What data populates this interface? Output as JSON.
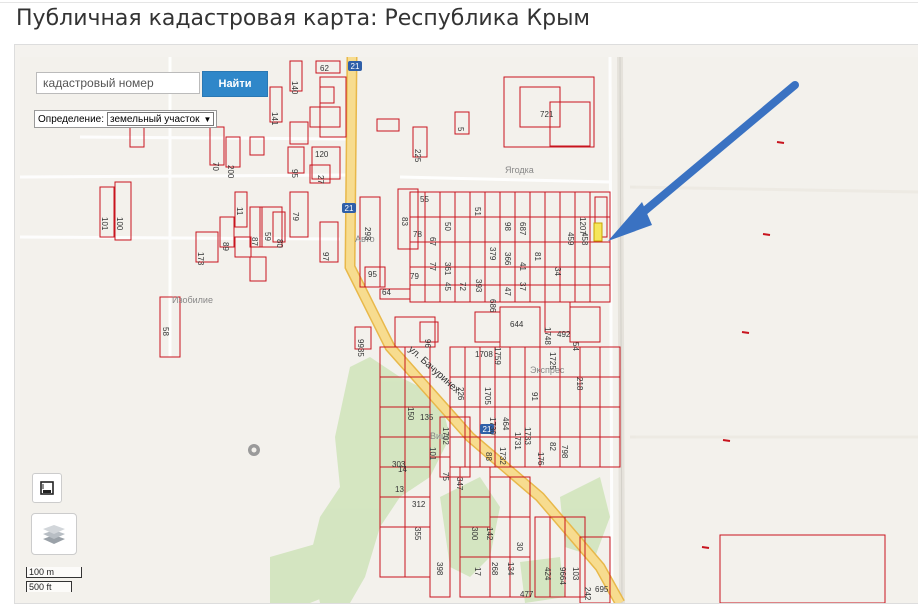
{
  "page": {
    "title": "Публичная кадастровая карта: Республика Крым"
  },
  "search": {
    "placeholder": "кадастровый номер",
    "button_label": "Найти"
  },
  "definition": {
    "label": "Определение:",
    "selected": "земельный участок"
  },
  "scale": {
    "metric": "100 m",
    "imperial": "500 ft"
  },
  "map": {
    "street_label": "ул. Бачуринех",
    "place_labels": [
      "Ягодка",
      "Изобилие",
      "Авто",
      "Экспрес",
      "Виш"
    ],
    "road_shields": [
      "21",
      "21",
      "21"
    ],
    "parcel_numbers": [
      "62",
      "140",
      "141",
      "5",
      "225",
      "721",
      "120",
      "27",
      "95",
      "70",
      "200",
      "101",
      "100",
      "11",
      "79",
      "87",
      "89",
      "59",
      "80",
      "173",
      "97",
      "58",
      "293",
      "83",
      "55",
      "50",
      "51",
      "98",
      "687",
      "1207",
      "78",
      "67",
      "379",
      "366",
      "459",
      "458",
      "77",
      "361",
      "41",
      "81",
      "79",
      "45",
      "72",
      "393",
      "686",
      "47",
      "37",
      "34",
      "95",
      "64",
      "644",
      "1748",
      "1725",
      "1759",
      "54",
      "492",
      "96",
      "9935",
      "1708",
      "1705",
      "218",
      "226",
      "91",
      "150",
      "135",
      "1702",
      "464",
      "1730",
      "1733",
      "1731",
      "1732",
      "88",
      "82",
      "798",
      "176",
      "101",
      "75",
      "347",
      "303",
      "14",
      "13",
      "312",
      "355",
      "300",
      "142",
      "398",
      "17",
      "268",
      "134",
      "30",
      "424",
      "9664",
      "103",
      "242",
      "695",
      "477"
    ]
  },
  "colors": {
    "parcel_stroke": "#c8141e",
    "road_fill": "#f7dc8f",
    "road_edge": "#e8b84a",
    "arrow": "#3a72c2",
    "highlight": "#f5e65a",
    "green_area": "#cfe6bd",
    "button": "#2f87c9"
  },
  "icons": [
    "layers-icon",
    "map-frame-icon",
    "road-shield-icon",
    "place-pin-icon"
  ]
}
